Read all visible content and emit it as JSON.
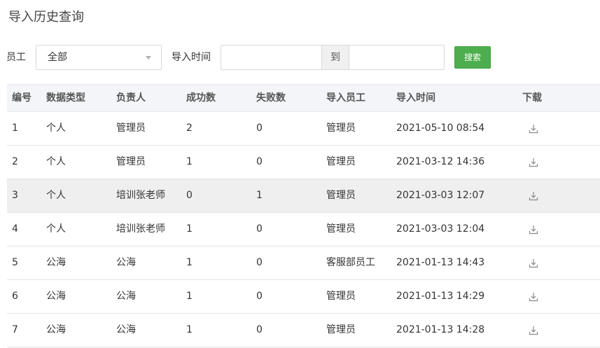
{
  "page": {
    "title": "导入历史查询"
  },
  "filters": {
    "employee_label": "员工",
    "employee_value": "全部",
    "import_time_label": "导入时间",
    "date_separator": "到",
    "search_label": "搜索"
  },
  "table": {
    "headers": [
      "编号",
      "数据类型",
      "负责人",
      "成功数",
      "失败数",
      "导入员工",
      "导入时间",
      "下载"
    ],
    "rows": [
      [
        "1",
        "个人",
        "管理员",
        "2",
        "0",
        "管理员",
        "2021-05-10 08:54"
      ],
      [
        "2",
        "个人",
        "管理员",
        "1",
        "0",
        "管理员",
        "2021-03-12 14:36"
      ],
      [
        "3",
        "个人",
        "培训张老师",
        "0",
        "1",
        "管理员",
        "2021-03-03 12:07"
      ],
      [
        "4",
        "个人",
        "培训张老师",
        "1",
        "0",
        "管理员",
        "2021-03-03 12:04"
      ],
      [
        "5",
        "公海",
        "公海",
        "1",
        "0",
        "客服部员工",
        "2021-01-13 14:43"
      ],
      [
        "6",
        "公海",
        "公海",
        "1",
        "0",
        "管理员",
        "2021-01-13 14:29"
      ],
      [
        "7",
        "公海",
        "公海",
        "1",
        "0",
        "管理员",
        "2021-01-13 14:28"
      ]
    ],
    "highlighted_row": 2
  },
  "colors": {
    "accent_button": "#4cae4c",
    "header_bg": "#f3f5f9"
  },
  "icons": {
    "download": "download-icon",
    "select_caret": "caret-down-icon"
  }
}
